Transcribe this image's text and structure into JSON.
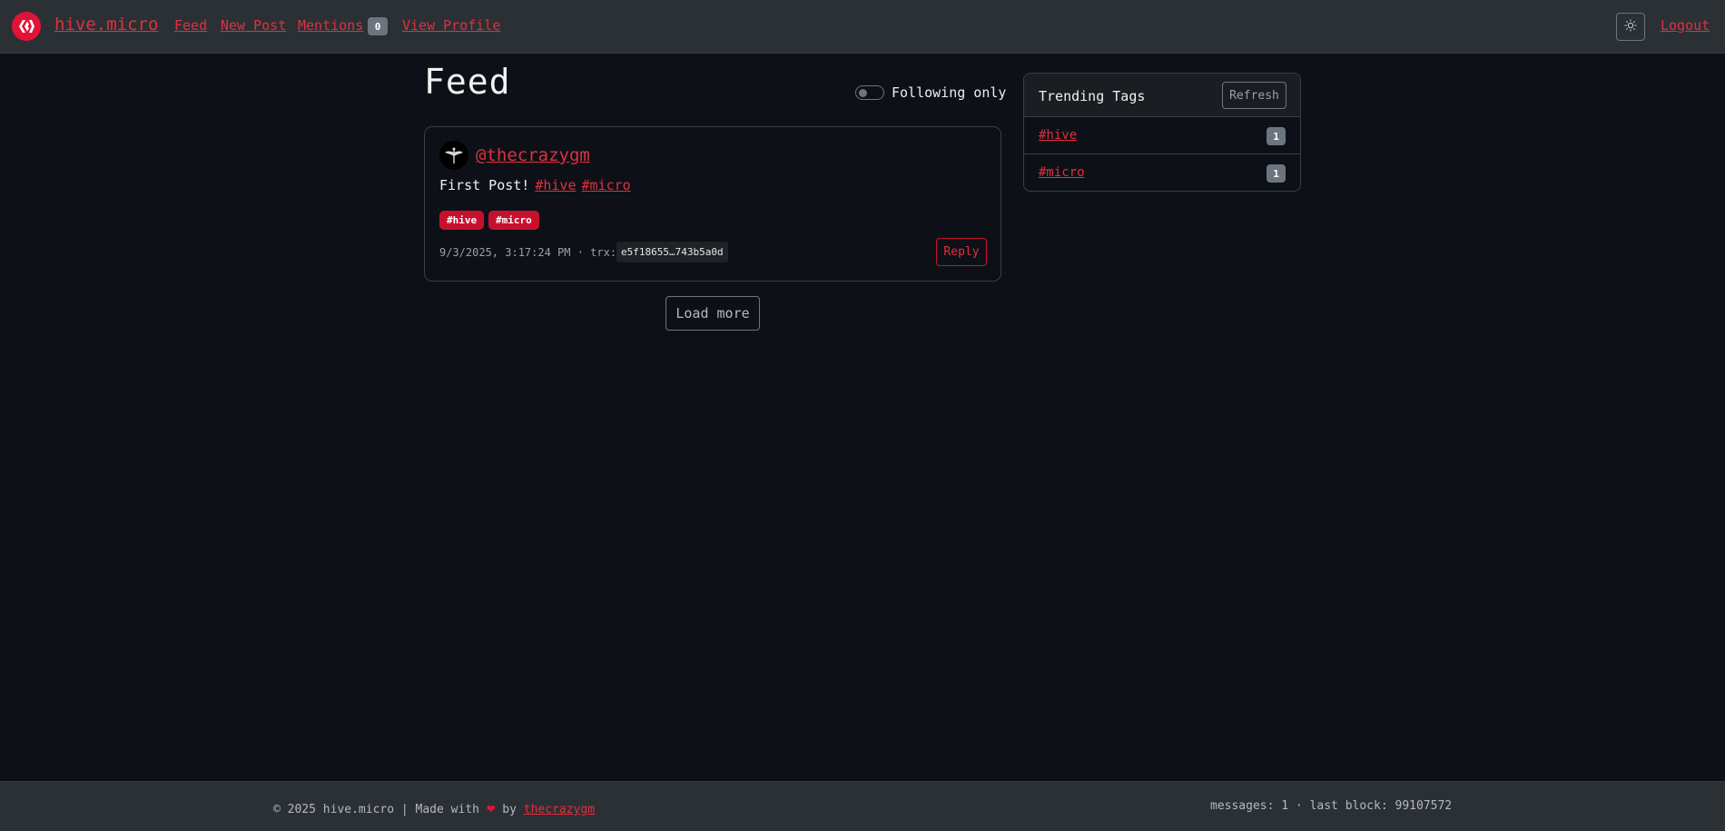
{
  "navbar": {
    "brand": "hive.micro",
    "links": {
      "feed": "Feed",
      "new_post": "New Post",
      "mentions": "Mentions",
      "view_profile": "View Profile"
    },
    "mentions_count": "0",
    "logout": "Logout",
    "theme_icon": "sun-icon",
    "brand_color": "#e31337"
  },
  "feed": {
    "title": "Feed",
    "following_only_label": "Following only",
    "following_only_enabled": false,
    "load_more": "Load more"
  },
  "posts": [
    {
      "author": "@thecrazygm",
      "body_text": "First Post!",
      "body_tags": [
        "#hive",
        "#micro"
      ],
      "tags": [
        "#hive",
        "#micro"
      ],
      "timestamp": "9/3/2025, 3:17:24 PM",
      "trx_label": "· trx:",
      "trx": "e5f18655…743b5a0d",
      "reply": "Reply"
    }
  ],
  "trending": {
    "title": "Trending Tags",
    "refresh": "Refresh",
    "tags": [
      {
        "name": "#hive",
        "count": "1"
      },
      {
        "name": "#micro",
        "count": "1"
      }
    ]
  },
  "footer": {
    "copyright": "© 2025 hive.micro | Made with",
    "by": "by",
    "author_link": "thecrazygm",
    "stats": "messages: 1 · last block: 99107572"
  }
}
